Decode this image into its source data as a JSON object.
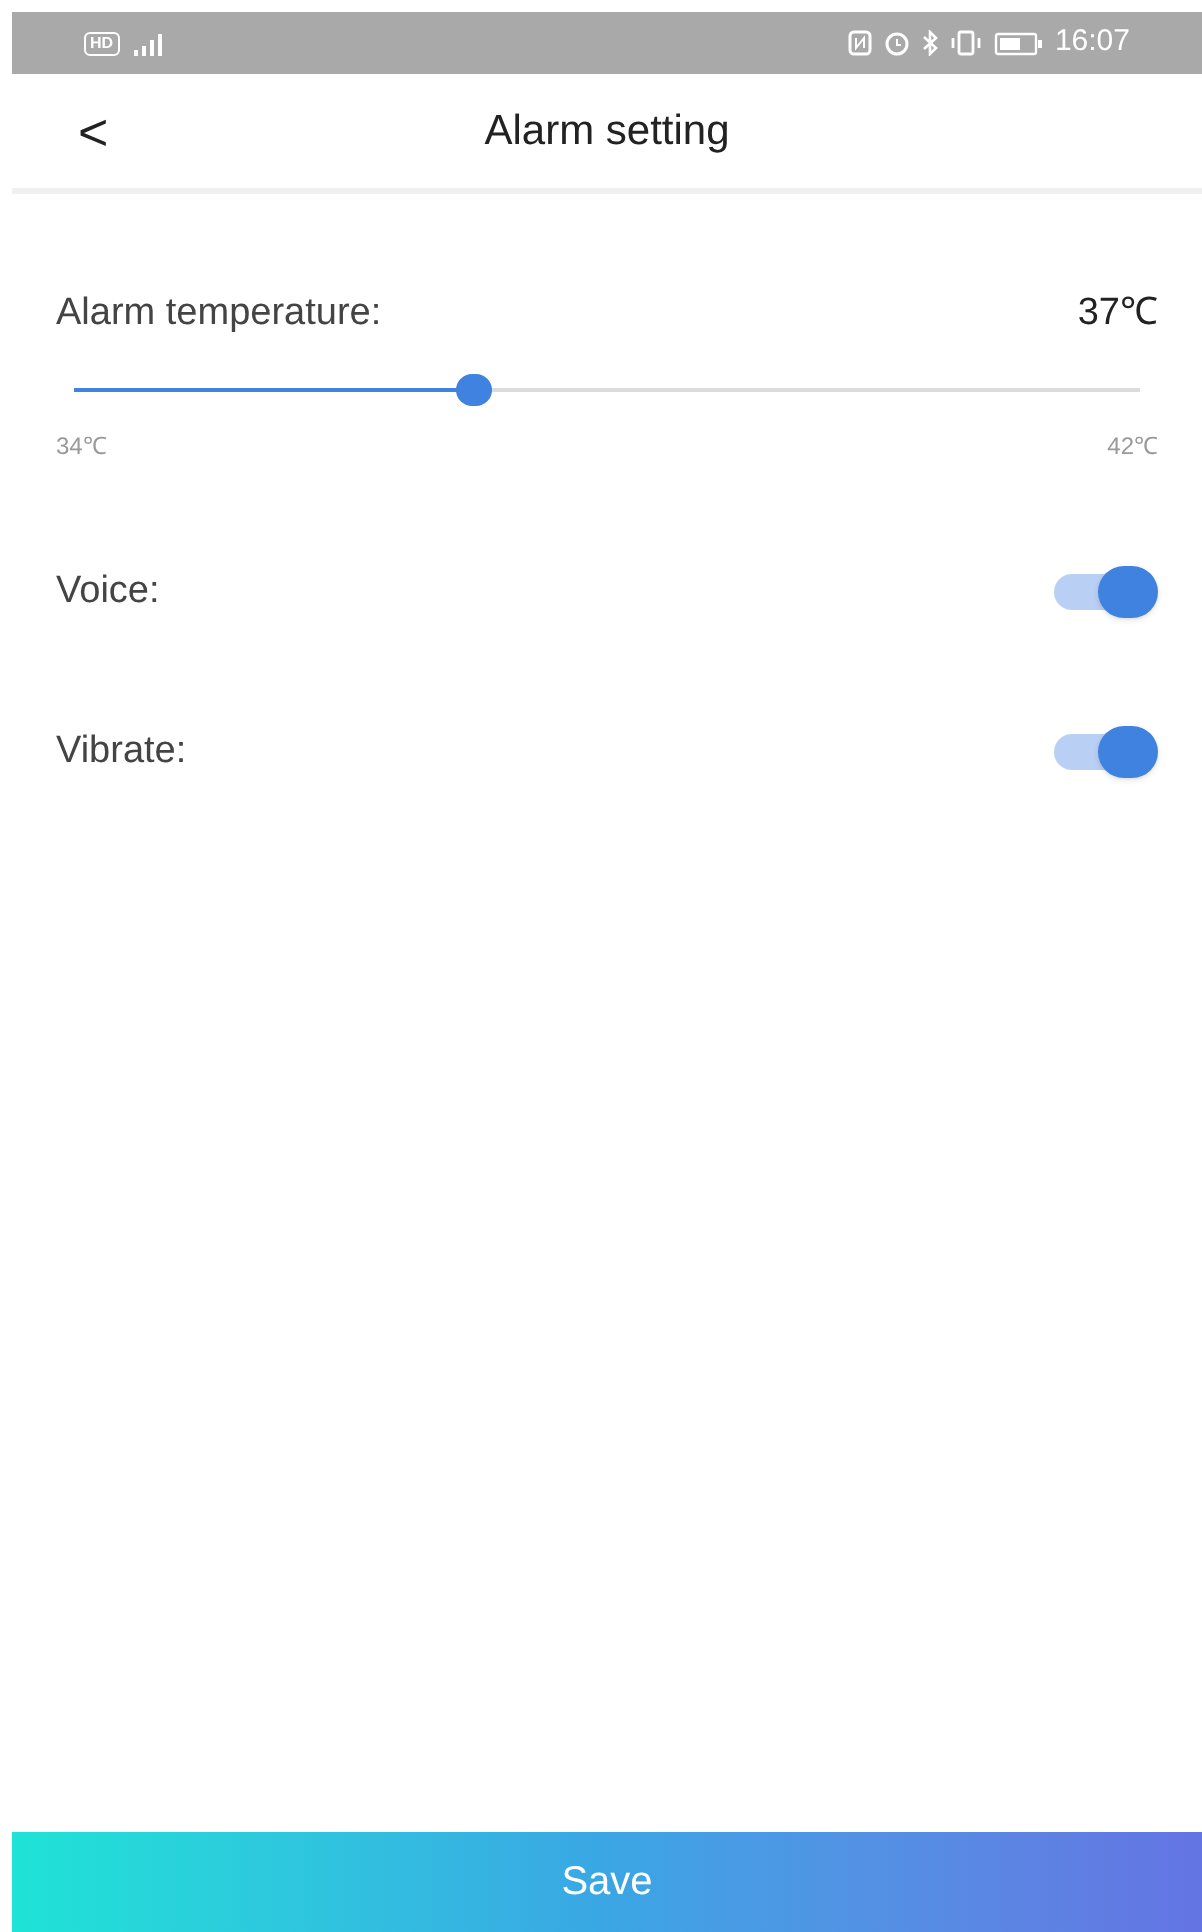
{
  "status_bar": {
    "badge": "HD",
    "time": "16:07"
  },
  "header": {
    "back": "<",
    "title": "Alarm setting"
  },
  "temperature": {
    "label": "Alarm temperature:",
    "value": "37℃",
    "level": 0.375,
    "min": "34℃",
    "max": "42℃"
  },
  "toggles": [
    {
      "label": "Voice:",
      "on": true
    },
    {
      "label": "Vibrate:",
      "on": true
    }
  ],
  "save_button": "Save"
}
